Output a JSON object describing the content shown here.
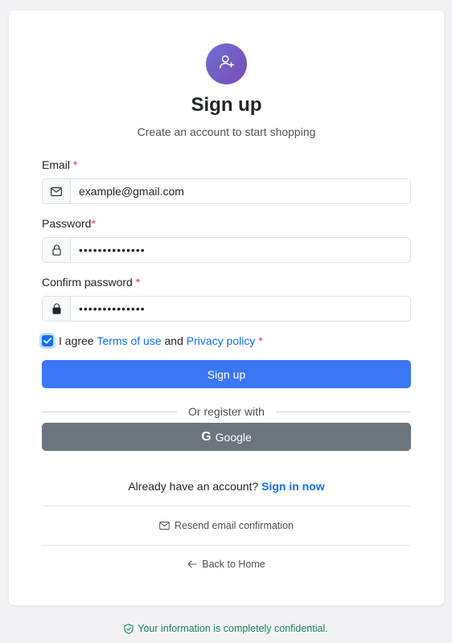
{
  "header": {
    "avatar_icon": "person-add-icon",
    "title": "Sign up",
    "subtitle": "Create an account to start shopping"
  },
  "form": {
    "email": {
      "label": "Email",
      "required_mark": "*",
      "icon": "envelope-icon",
      "value": "example@gmail.com"
    },
    "password": {
      "label": "Password",
      "required_mark": "*",
      "icon": "lock-outline-icon",
      "value": "••••••••••••••"
    },
    "confirm_password": {
      "label": "Confirm password",
      "required_mark": "*",
      "icon": "lock-fill-icon",
      "value": "••••••••••••••"
    },
    "agree": {
      "checked": true,
      "prefix": "I agree",
      "terms": "Terms of use",
      "and": "and",
      "privacy": "Privacy policy",
      "required_mark": "*"
    },
    "submit_label": "Sign up"
  },
  "social": {
    "divider_text": "Or register with",
    "google_label": "Google",
    "google_icon": "G"
  },
  "signin": {
    "prompt": "Already have an account?",
    "link": "Sign in now"
  },
  "links": {
    "resend": "Resend email confirmation",
    "back": "Back to Home"
  },
  "footer": {
    "confidential": "Your information is completely confidential."
  },
  "colors": {
    "primary": "#3b76f6",
    "link": "#0d6efd",
    "secondary": "#6c757d",
    "required": "#dc3545",
    "success": "#198754",
    "avatar_gradient": [
      "#6e6fd4",
      "#7b4bb7"
    ]
  }
}
